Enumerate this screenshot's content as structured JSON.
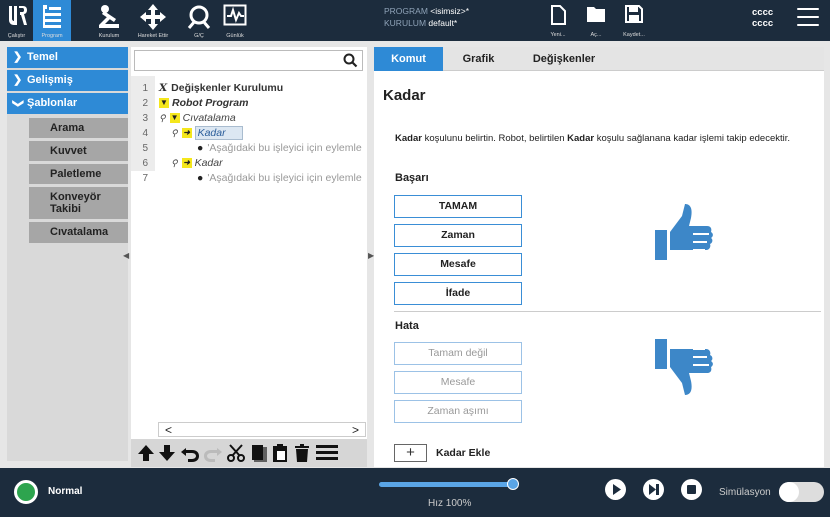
{
  "topbar": {
    "nav": [
      {
        "label": "Çalıştır",
        "icon": "ur-logo-icon"
      },
      {
        "label": "Program",
        "icon": "program-tree-icon"
      },
      {
        "label": "Kurulum",
        "icon": "robot-arm-icon"
      },
      {
        "label": "Hareket Ettir",
        "icon": "move-arrows-icon"
      },
      {
        "label": "G/Ç",
        "icon": "io-icon"
      },
      {
        "label": "Günlük",
        "icon": "log-chart-icon"
      }
    ],
    "program_key": "PROGRAM",
    "program_val": "<isimsiz>*",
    "installation_key": "KURULUM",
    "installation_val": "default*",
    "file": {
      "new": "Yeni...",
      "open": "Aç...",
      "save": "Kaydet..."
    },
    "user_line1": "cccc",
    "user_line2": "cccc"
  },
  "left_nav": {
    "categories": [
      "Temel",
      "Gelişmiş",
      "Şablonlar"
    ],
    "templates": [
      "Arama",
      "Kuvvet",
      "Paletleme",
      "Konveyör Takibi",
      "Cıvatalama"
    ]
  },
  "tree": {
    "rows": [
      {
        "num": "1",
        "text": "Değişkenler Kurulumu"
      },
      {
        "num": "2",
        "text": "Robot Program"
      },
      {
        "num": "3",
        "text": "Cıvatalama"
      },
      {
        "num": "4",
        "text": "Kadar"
      },
      {
        "num": "5",
        "text": "'Aşağıdaki bu işleyici için eylemle"
      },
      {
        "num": "6",
        "text": "Kadar"
      },
      {
        "num": "7",
        "text": "'Aşağıdaki bu işleyici için eylemle"
      }
    ],
    "scroll_left": "<",
    "scroll_right": ">"
  },
  "right": {
    "tabs": [
      "Komut",
      "Grafik",
      "Değişkenler"
    ],
    "title": "Kadar",
    "desc_1": "Kadar",
    "desc_2": " koşulunu belirtin. Robot, belirtilen ",
    "desc_3": "Kadar",
    "desc_4": " koşulu sağlanana kadar işlemi takip edecektir.",
    "success_title": "Başarı",
    "success_buttons": [
      "TAMAM",
      "Zaman",
      "Mesafe",
      "İfade"
    ],
    "fail_title": "Hata",
    "fail_buttons": [
      "Tamam değil",
      "Mesafe",
      "Zaman aşımı"
    ],
    "add_symbol": "+",
    "add_label": "Kadar Ekle"
  },
  "bottombar": {
    "status": "Normal",
    "speed": "Hız 100%",
    "speed_fraction": 1.0,
    "simulation": "Simülasyon"
  },
  "colors": {
    "accent": "#2e8ad6",
    "topbar": "#1c2c3d",
    "thumb": "#3d87c8"
  }
}
